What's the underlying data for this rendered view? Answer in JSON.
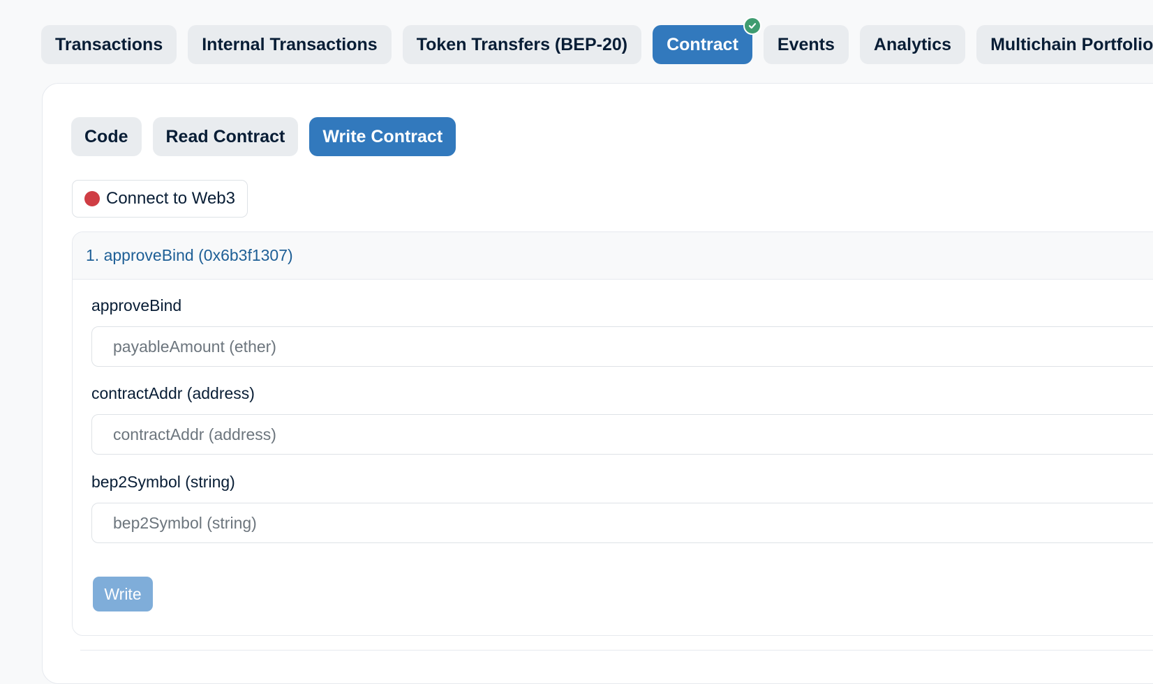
{
  "top_tabs": [
    {
      "label": "Transactions"
    },
    {
      "label": "Internal Transactions"
    },
    {
      "label": "Token Transfers (BEP-20)"
    },
    {
      "label": "Contract"
    },
    {
      "label": "Events"
    },
    {
      "label": "Analytics"
    },
    {
      "label": "Multichain Portfolio"
    }
  ],
  "sub_tabs": [
    {
      "label": "Code"
    },
    {
      "label": "Read Contract"
    },
    {
      "label": "Write Contract"
    }
  ],
  "connect_button": {
    "label": "Connect to Web3",
    "status_color": "#cf3d44"
  },
  "function": {
    "header": "1. approveBind (0x6b3f1307)",
    "fields": [
      {
        "label": "approveBind",
        "placeholder": "payableAmount (ether)"
      },
      {
        "label": "contractAddr (address)",
        "placeholder": "contractAddr (address)"
      },
      {
        "label": "bep2Symbol (string)",
        "placeholder": "bep2Symbol (string)"
      }
    ],
    "write_label": "Write"
  },
  "colors": {
    "accent": "#3279bd",
    "verified": "#3f9c70",
    "link": "#1e5f96"
  }
}
